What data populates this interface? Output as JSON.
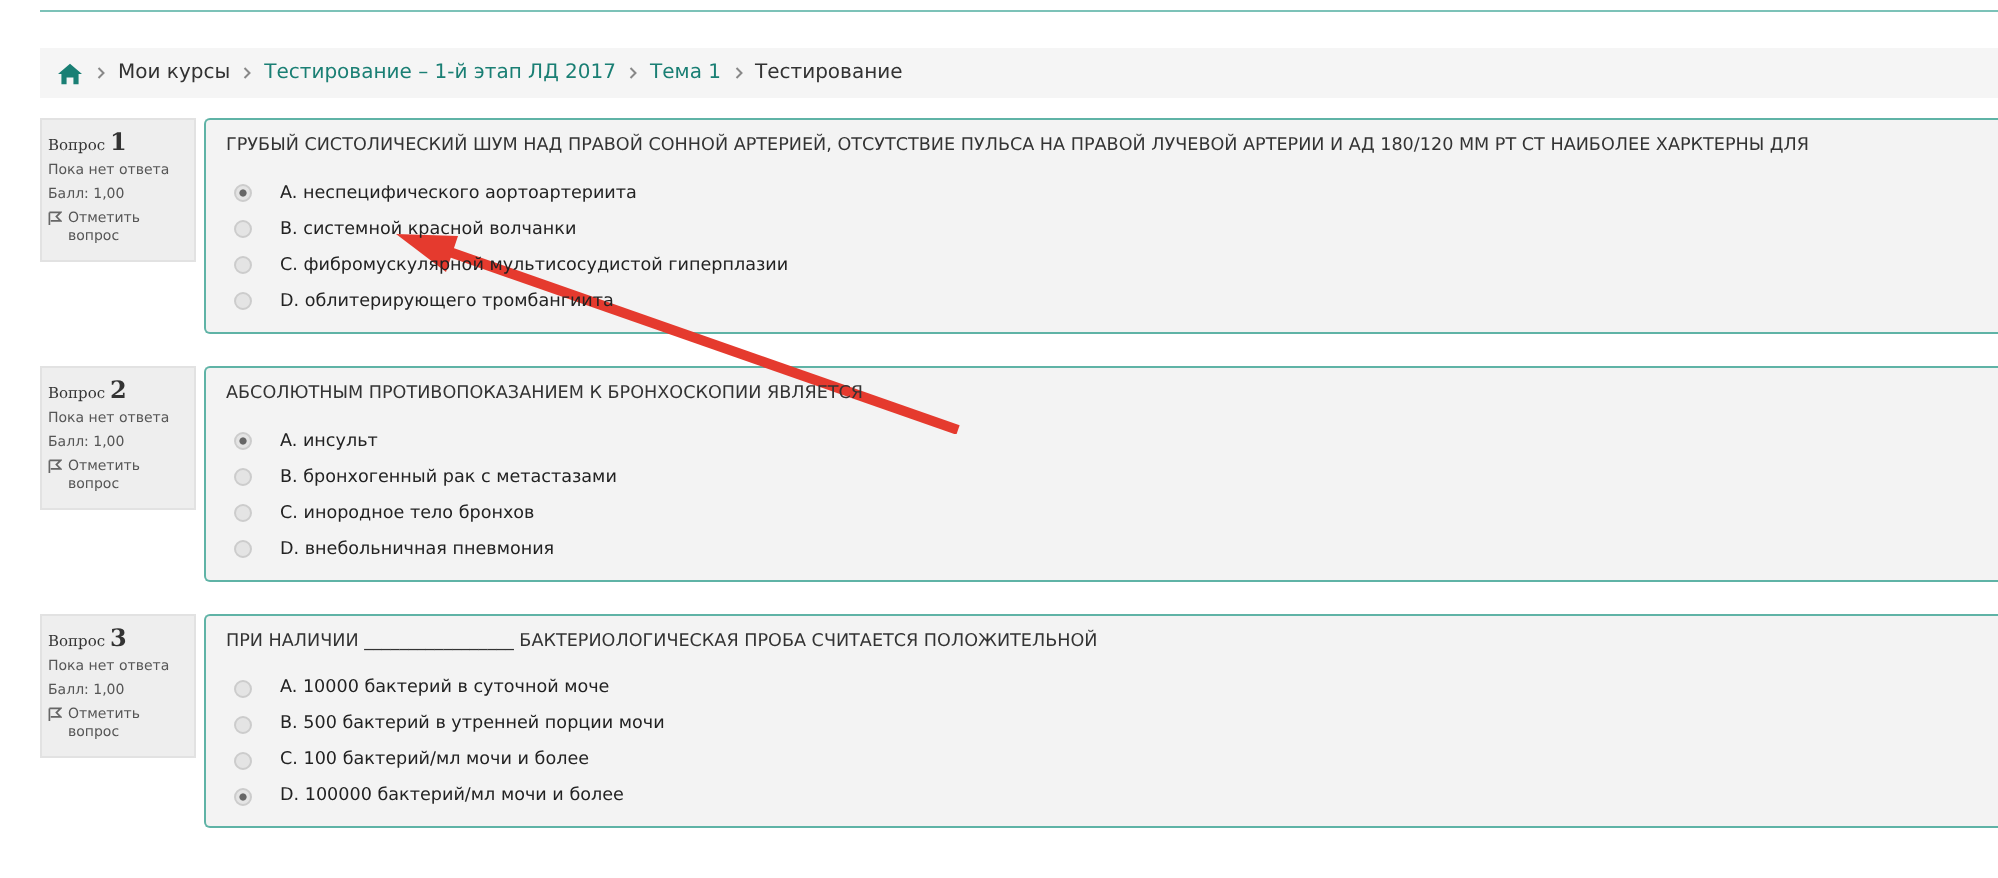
{
  "breadcrumb": [
    {
      "text": "Мои курсы",
      "link": false
    },
    {
      "text": "Тестирование – 1-й этап ЛД 2017",
      "link": true
    },
    {
      "text": "Тема 1",
      "link": true
    },
    {
      "text": "Тестирование",
      "link": false
    }
  ],
  "questions": [
    {
      "label": "Вопрос",
      "number": "1",
      "status": "Пока нет ответа",
      "score": "Балл: 1,00",
      "flag": "Отметить вопрос",
      "text": "ГРУБЫЙ СИСТОЛИЧЕСКИЙ ШУМ НАД ПРАВОЙ СОННОЙ АРТЕРИЕЙ, ОТСУТСТВИЕ ПУЛЬСА НА ПРАВОЙ ЛУЧЕВОЙ АРТЕРИИ И АД 180/120 ММ РТ СТ НАИБОЛЕЕ ХАРКТЕРНЫ ДЛЯ",
      "options": [
        {
          "text": "A. неспецифического аортоартериита",
          "selected": true
        },
        {
          "text": "B. системной красной волчанки",
          "selected": false
        },
        {
          "text": "C. фибромускулярной мультисосудистой гиперплазии",
          "selected": false
        },
        {
          "text": "D. облитерирующего тромбангиита",
          "selected": false
        }
      ]
    },
    {
      "label": "Вопрос",
      "number": "2",
      "status": "Пока нет ответа",
      "score": "Балл: 1,00",
      "flag": "Отметить вопрос",
      "text": "АБСОЛЮТНЫМ ПРОТИВОПОКАЗАНИЕМ К БРОНХОСКОПИИ ЯВЛЯЕТСЯ",
      "options": [
        {
          "text": "A. инсульт",
          "selected": true
        },
        {
          "text": "B. бронхогенный рак с метастазами",
          "selected": false
        },
        {
          "text": "C. инородное тело бронхов",
          "selected": false
        },
        {
          "text": "D. внебольничная пневмония",
          "selected": false
        }
      ]
    },
    {
      "label": "Вопрос",
      "number": "3",
      "status": "Пока нет ответа",
      "score": "Балл: 1,00",
      "flag": "Отметить вопрос",
      "text": "ПРИ НАЛИЧИИ _________________ БАКТЕРИОЛОГИЧЕСКАЯ ПРОБА СЧИТАЕТСЯ ПОЛОЖИТЕЛЬНОЙ",
      "options": [
        {
          "text": "A. 10000 бактерий в суточной моче",
          "selected": false
        },
        {
          "text": "B. 500 бактерий в утренней порции мочи",
          "selected": false
        },
        {
          "text": "C. 100 бактерий/мл мочи и более",
          "selected": false
        },
        {
          "text": "D. 100000 бактерий/мл мочи и более",
          "selected": true
        }
      ]
    }
  ]
}
